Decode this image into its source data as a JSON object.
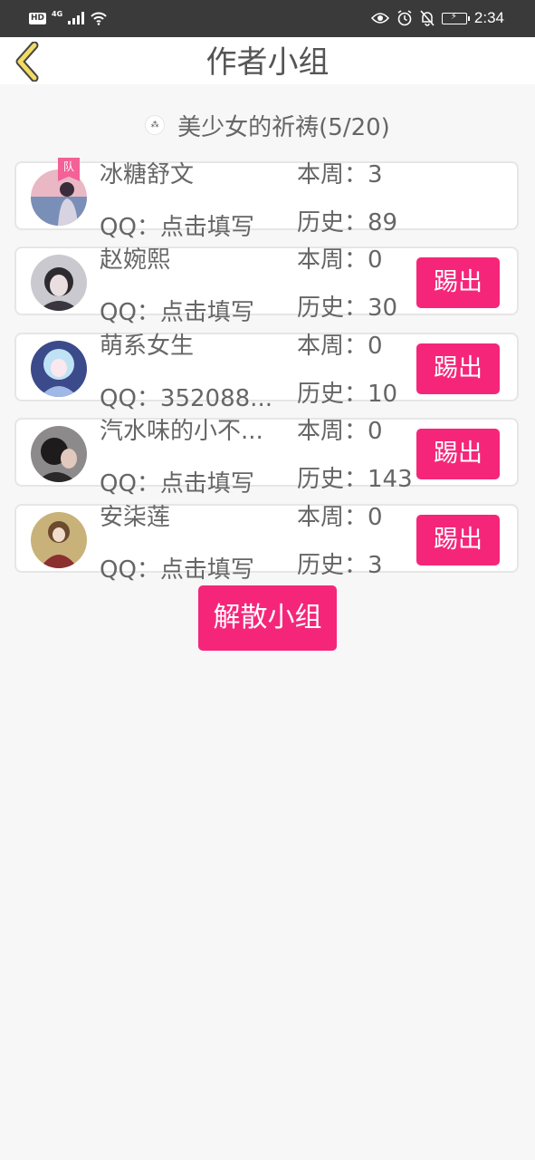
{
  "status_bar": {
    "left_badge": "HD",
    "network": "4G",
    "time": "2:34"
  },
  "header": {
    "title": "作者小组"
  },
  "group": {
    "name": "美少女的祈祷(5/20)"
  },
  "members": [
    {
      "name": "冰糖舒文",
      "qq": "QQ：点击填写",
      "week": "本周：3",
      "history": "历史：89",
      "leader_badge": "队",
      "kick_label": ""
    },
    {
      "name": "赵婉熙",
      "qq": "QQ：点击填写",
      "week": "本周：0",
      "history": "历史：30",
      "kick_label": "踢出"
    },
    {
      "name": "萌系女生",
      "qq": "QQ：352088...",
      "week": "本周：0",
      "history": "历史：10",
      "kick_label": "踢出"
    },
    {
      "name": "汽水味的小不...",
      "qq": "QQ：点击填写",
      "week": "本周：0",
      "history": "历史：143",
      "kick_label": "踢出"
    },
    {
      "name": "安柒莲",
      "qq": "QQ：点击填写",
      "week": "本周：0",
      "history": "历史：3",
      "kick_label": "踢出"
    }
  ],
  "actions": {
    "dissolve_label": "解散小组"
  },
  "colors": {
    "accent": "#f5267a",
    "status_bar": "#3a3a3a",
    "back_arrow": "#f2dc62"
  }
}
